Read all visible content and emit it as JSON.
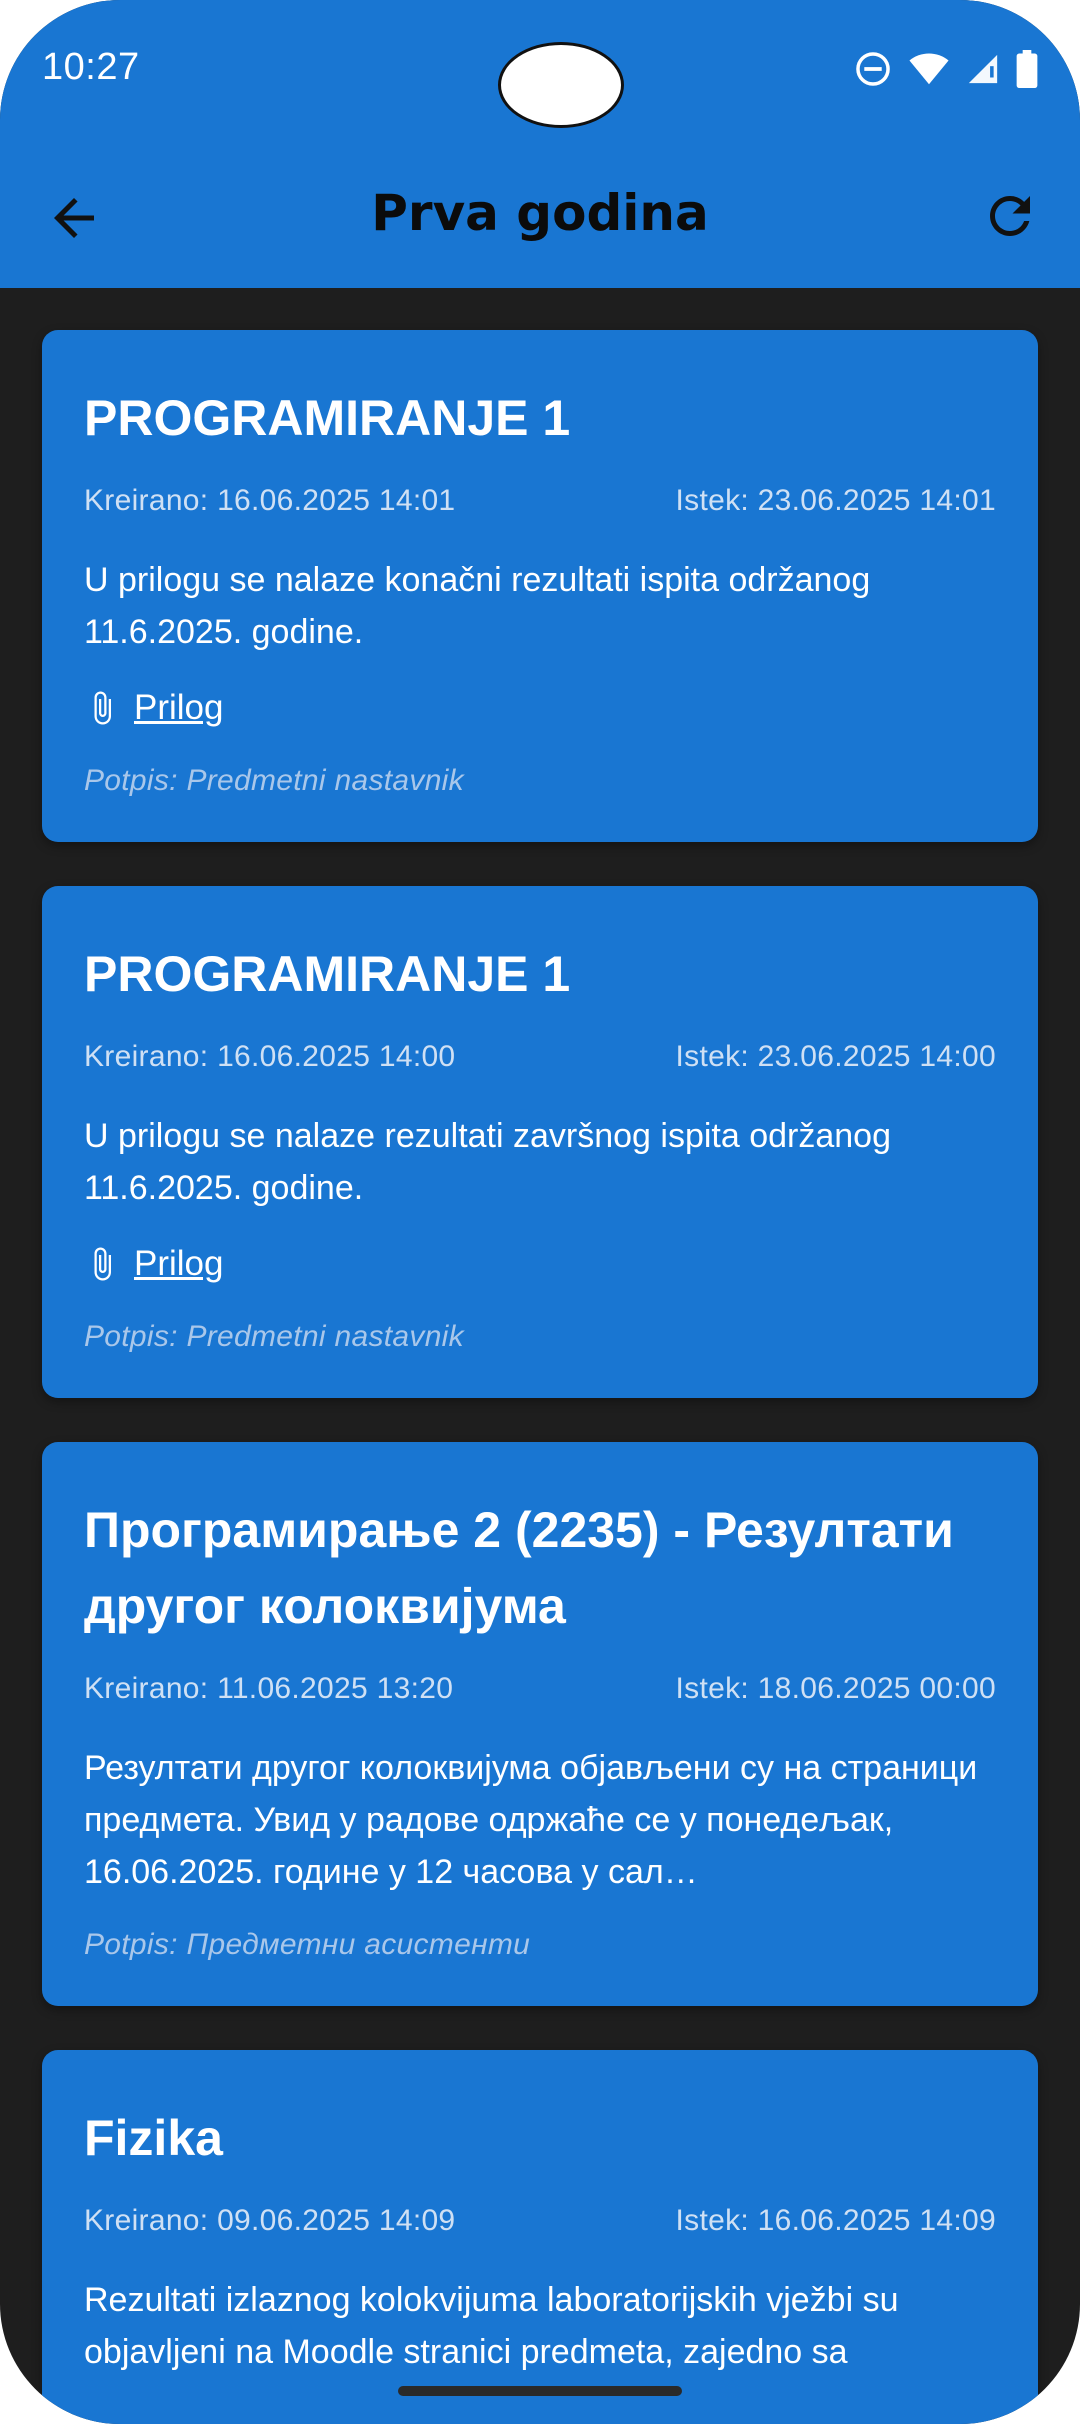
{
  "status": {
    "time": "10:27"
  },
  "appbar": {
    "title": "Prva godina"
  },
  "cards": [
    {
      "title": "PROGRAMIRANJE 1",
      "created": "Kreirano: 16.06.2025 14:01",
      "expires": "Istek: 23.06.2025 14:01",
      "description": "U prilogu se nalaze konačni rezultati ispita održanog 11.6.2025. godine.",
      "attachment": "Prilog",
      "signature": "Potpis: Predmetni nastavnik"
    },
    {
      "title": "PROGRAMIRANJE 1",
      "created": "Kreirano: 16.06.2025 14:00",
      "expires": "Istek: 23.06.2025 14:00",
      "description": "U prilogu se nalaze rezultati završnog ispita održanog 11.6.2025. godine.",
      "attachment": "Prilog",
      "signature": "Potpis: Predmetni nastavnik"
    },
    {
      "title": "Програмирање 2 (2235) - Резултати другог колоквијума",
      "created": "Kreirano: 11.06.2025 13:20",
      "expires": "Istek: 18.06.2025 00:00",
      "description": "Резултати другог колоквијума објављени су на страници предмета. Увид у радове одржаће се у понедељак, 16.06.2025. године у 12 часова у сал…",
      "signature": "Potpis: Предметни асистенти"
    },
    {
      "title": "Fizika",
      "created": "Kreirano: 09.06.2025 14:09",
      "expires": "Istek: 16.06.2025 14:09",
      "description": "Rezultati izlaznog kolokvijuma laboratorijskih vježbi su objavljeni na Moodle stranici predmeta, zajedno sa"
    }
  ],
  "icons": {
    "back": "arrow-left-icon",
    "refresh": "refresh-icon",
    "attachment": "paperclip-icon"
  },
  "colors": {
    "primary": "#1976d2",
    "background": "#1e1e1e"
  }
}
